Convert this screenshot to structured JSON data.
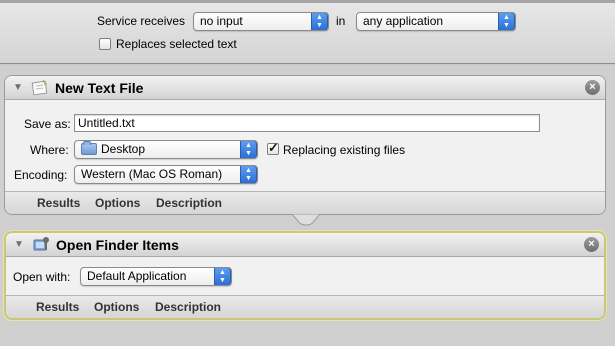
{
  "service": {
    "receives_label": "Service receives",
    "input_value": "no input",
    "in_label": "in",
    "application_value": "any application",
    "replaces_label": "Replaces selected text",
    "replaces_checked": false
  },
  "actions": [
    {
      "title": "New Text File",
      "icon": "text-file-icon",
      "save_as_label": "Save as:",
      "save_as_value": "Untitled.txt",
      "where_label": "Where:",
      "where_value": "Desktop",
      "replacing_label": "Replacing existing files",
      "replacing_checked": true,
      "encoding_label": "Encoding:",
      "encoding_value": "Western (Mac OS Roman)",
      "footer": [
        "Results",
        "Options",
        "Description"
      ]
    },
    {
      "title": "Open Finder Items",
      "icon": "finder-icon",
      "open_with_label": "Open with:",
      "open_with_value": "Default Application",
      "footer": [
        "Results",
        "Options",
        "Description"
      ]
    }
  ],
  "colors": {
    "accent_blue": "#2a6fd6",
    "selection_border": "#c9c77a"
  }
}
